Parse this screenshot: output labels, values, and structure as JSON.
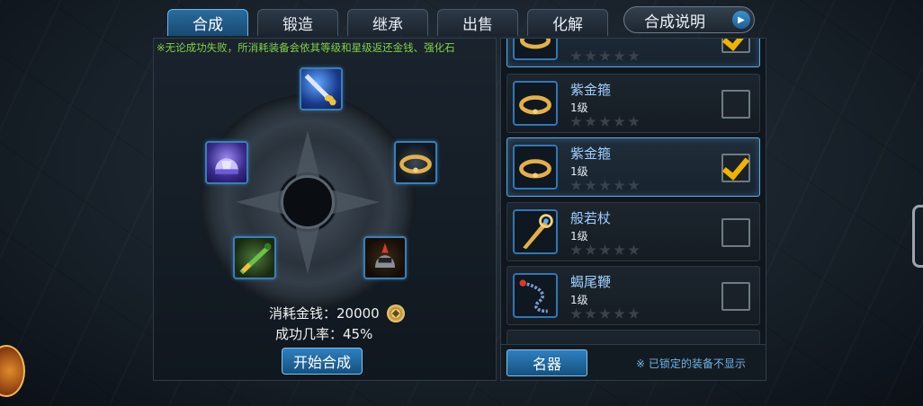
{
  "tabs": [
    {
      "label": "合成",
      "active": true
    },
    {
      "label": "锻造",
      "active": false
    },
    {
      "label": "继承",
      "active": false
    },
    {
      "label": "出售",
      "active": false
    },
    {
      "label": "化解",
      "active": false
    }
  ],
  "help_button": {
    "label": "合成说明"
  },
  "notice": "※无论成功失败，所消耗装备会依其等级和星级返还金钱、强化石",
  "cost": {
    "label": "消耗金钱：20000"
  },
  "rate": {
    "label": "成功几率：45%"
  },
  "start_button": {
    "label": "开始合成"
  },
  "equipment_list": [
    {
      "name": "",
      "level": "",
      "checked": true,
      "selected": true,
      "icon": "bracelet-icon"
    },
    {
      "name": "紫金箍",
      "level": "1级",
      "checked": false,
      "selected": false,
      "icon": "gold-ring-icon"
    },
    {
      "name": "紫金箍",
      "level": "1级",
      "checked": true,
      "selected": true,
      "icon": "gold-ring-icon"
    },
    {
      "name": "般若杖",
      "level": "1级",
      "checked": false,
      "selected": false,
      "icon": "staff-icon"
    },
    {
      "name": "蝎尾鞭",
      "level": "1级",
      "checked": false,
      "selected": false,
      "icon": "whip-icon"
    }
  ],
  "filter_button": {
    "label": "名器"
  },
  "lock_note": "※ 已锁定的装备不显示",
  "colors": {
    "accent": "#2f7fbf",
    "notice_green": "#7fd24a",
    "item_name": "#9fd0ff",
    "check_gold": "#f0b400"
  }
}
